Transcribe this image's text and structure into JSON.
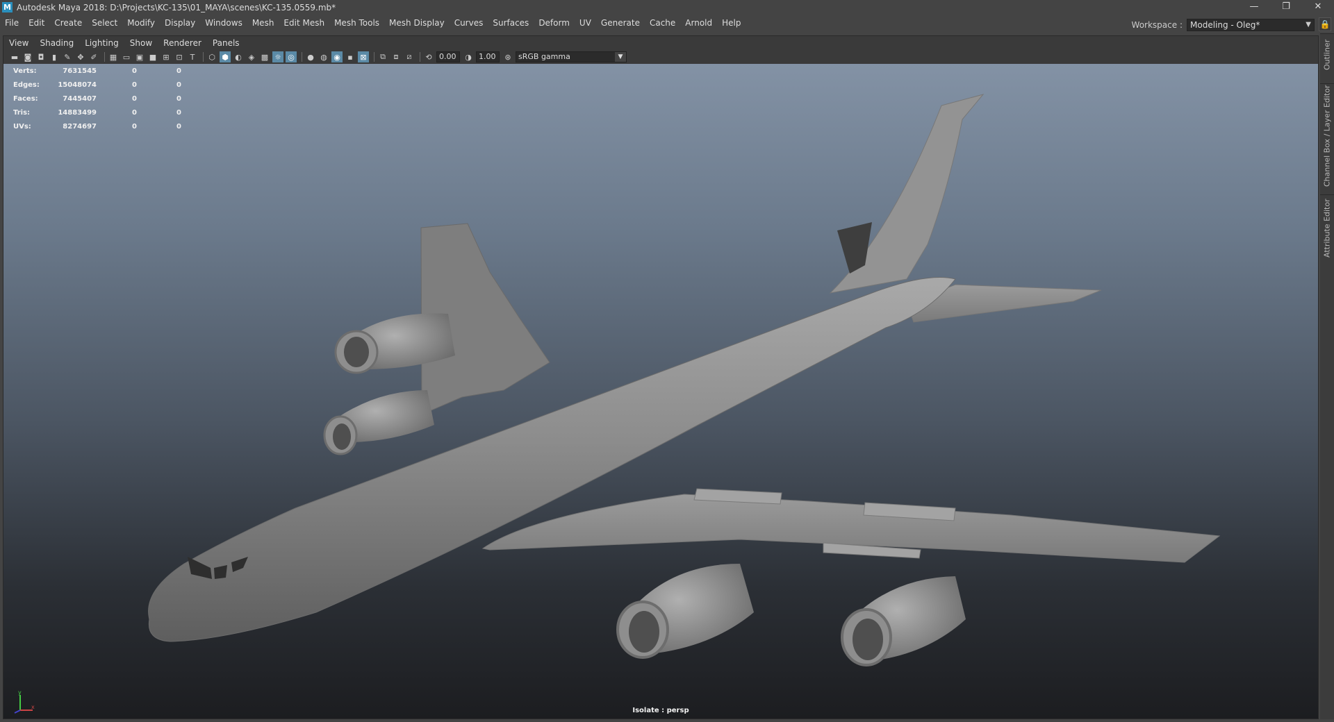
{
  "window": {
    "title": "Autodesk Maya 2018: D:\\Projects\\KC-135\\01_MAYA\\scenes\\KC-135.0559.mb*",
    "app_icon": "M",
    "minimize": "—",
    "restore": "❐",
    "close": "✕"
  },
  "menubar": {
    "items": [
      "File",
      "Edit",
      "Create",
      "Select",
      "Modify",
      "Display",
      "Windows",
      "Mesh",
      "Edit Mesh",
      "Mesh Tools",
      "Mesh Display",
      "Curves",
      "Surfaces",
      "Deform",
      "UV",
      "Generate",
      "Cache",
      "Arnold",
      "Help"
    ],
    "workspace_label": "Workspace :",
    "workspace_value": "Modeling - Oleg*"
  },
  "panel_menu": {
    "items": [
      "View",
      "Shading",
      "Lighting",
      "Show",
      "Renderer",
      "Panels"
    ]
  },
  "toolbar": {
    "exposure": "0.00",
    "gamma": "1.00",
    "color_space": "sRGB gamma"
  },
  "hud": {
    "rows": [
      {
        "label": "Verts:",
        "value": "7631545",
        "sel": "0",
        "comp": "0"
      },
      {
        "label": "Edges:",
        "value": "15048074",
        "sel": "0",
        "comp": "0"
      },
      {
        "label": "Faces:",
        "value": "7445407",
        "sel": "0",
        "comp": "0"
      },
      {
        "label": "Tris:",
        "value": "14883499",
        "sel": "0",
        "comp": "0"
      },
      {
        "label": "UVs:",
        "value": "8274697",
        "sel": "0",
        "comp": "0"
      }
    ]
  },
  "viewport": {
    "camera_label": "Isolate : persp",
    "axis_y": "y",
    "axis_x": "x"
  },
  "side_tabs": [
    "Outliner",
    "Channel Box / Layer Editor",
    "Attribute Editor"
  ],
  "colors": {
    "bg_top": "#8392a5",
    "bg_bottom": "#1c1d20",
    "ui_panel": "#444444",
    "model_gray": "#8e8e8e"
  }
}
